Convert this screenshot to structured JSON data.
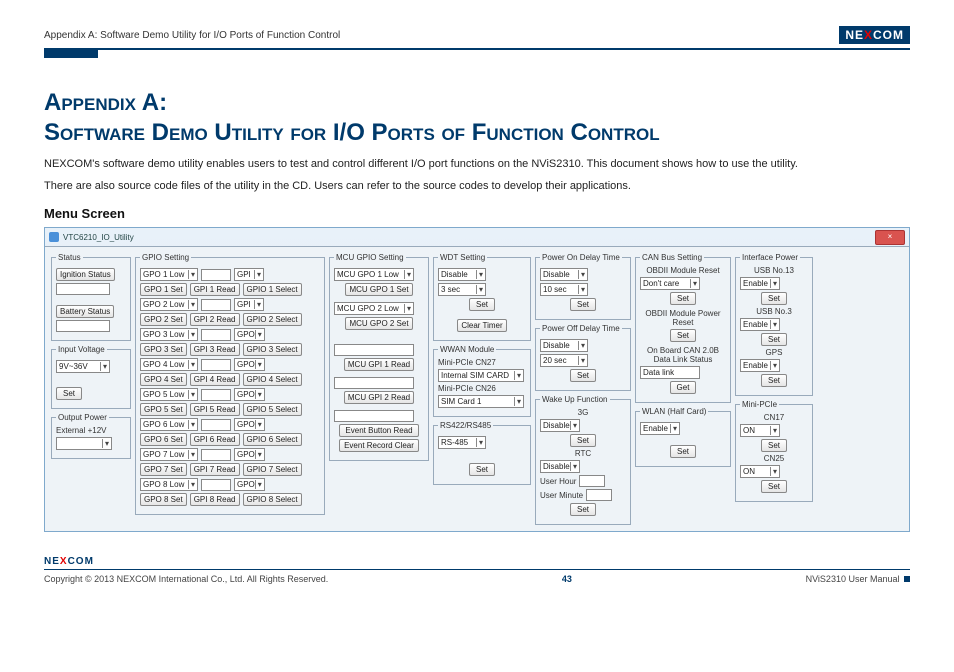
{
  "header": {
    "crumb": "Appendix A: Software Demo Utility for I/O Ports of Function Control",
    "brand_pre": "NE",
    "brand_x": "X",
    "brand_post": "COM"
  },
  "title_line1": "Appendix A:",
  "title_line2": "Software Demo Utility for I/O Ports of Function Control",
  "para1": "NEXCOM's software demo utility enables users to test and control different I/O port functions on the NViS2310. This document shows how to use the utility.",
  "para2": "There are also source code files of the utility in the CD. Users can refer to the source codes to develop their applications.",
  "menu_heading": "Menu Screen",
  "win": {
    "title": "VTC6210_IO_Utility",
    "close": "×",
    "status": {
      "legend": "Status",
      "btn1": "Ignition Status",
      "btn2": "Battery Status"
    },
    "inputv": {
      "legend": "Input Voltage",
      "sel": "9V~36V",
      "btn": "Set"
    },
    "outp": {
      "legend": "Output Power",
      "lbl": "External +12V"
    },
    "gpio": {
      "legend": "GPIO Setting",
      "rows": [
        {
          "sel": "GPO 1 Low",
          "set": "GPO 1 Set",
          "read": "GPI 1 Read",
          "sbtn": "GPIO 1 Select",
          "sel2": "GPI"
        },
        {
          "sel": "GPO 2 Low",
          "set": "GPO 2 Set",
          "read": "GPI 2 Read",
          "sbtn": "GPIO 2 Select",
          "sel2": "GPI"
        },
        {
          "sel": "GPO 3 Low",
          "set": "GPO 3 Set",
          "read": "GPI 3 Read",
          "sbtn": "GPIO 3 Select",
          "sel2": "GPO"
        },
        {
          "sel": "GPO 4 Low",
          "set": "GPO 4 Set",
          "read": "GPI 4 Read",
          "sbtn": "GPIO 4 Select",
          "sel2": "GPO"
        },
        {
          "sel": "GPO 5 Low",
          "set": "GPO 5 Set",
          "read": "GPI 5 Read",
          "sbtn": "GPIO 5 Select",
          "sel2": "GPO"
        },
        {
          "sel": "GPO 6 Low",
          "set": "GPO 6 Set",
          "read": "GPI 6 Read",
          "sbtn": "GPIO 6 Select",
          "sel2": "GPO"
        },
        {
          "sel": "GPO 7 Low",
          "set": "GPO 7 Set",
          "read": "GPI 7 Read",
          "sbtn": "GPIO 7 Select",
          "sel2": "GPO"
        },
        {
          "sel": "GPO 8 Low",
          "set": "GPO 8 Set",
          "read": "GPI 8 Read",
          "sbtn": "GPIO 8 Select",
          "sel2": "GPO"
        }
      ]
    },
    "mcugpio": {
      "legend": "MCU GPIO Setting",
      "sel1": "MCU GPO 1 Low",
      "btn1": "MCU GPO 1 Set",
      "sel2": "MCU GPO 2 Low",
      "btn2": "MCU GPO 2 Set",
      "btn3": "MCU GPI 1 Read",
      "btn4": "MCU GPI 2 Read",
      "btn5": "Event Button Read",
      "btn6": "Event Record Clear"
    },
    "wdt": {
      "legend": "WDT Setting",
      "sel1": "Disable",
      "sel2": "3 sec",
      "btn1": "Set",
      "btn2": "Clear Timer"
    },
    "wwan": {
      "legend": "WWAN Module",
      "l1": "Mini-PCIe CN27",
      "sel1": "Internal SIM CARD",
      "l2": "Mini-PCIe CN26",
      "sel2": "SIM Card 1"
    },
    "rs": {
      "legend": "RS422/RS485",
      "sel": "RS-485",
      "btn": "Set"
    },
    "pon": {
      "legend": "Power On Delay Time",
      "sel1": "Disable",
      "sel2": "10 sec",
      "btn": "Set"
    },
    "poff": {
      "legend": "Power Off Delay Time",
      "sel1": "Disable",
      "sel2": "20 sec",
      "btn": "Set"
    },
    "wake": {
      "legend": "Wake Up Function",
      "l1": "3G",
      "sel1": "Disable",
      "btn1": "Set",
      "l2": "RTC",
      "sel2": "Disable",
      "l3": "User Hour",
      "l4": "User Minute",
      "btn2": "Set"
    },
    "can": {
      "legend": "CAN Bus Setting",
      "l1": "OBDII Module Reset",
      "sel1": "Don't care",
      "btn1": "Set",
      "l2": "OBDII Module Power Reset",
      "btn2": "Set",
      "l3": "On Board CAN 2.0B Data Link Status",
      "sel3": "Data link",
      "btn3": "Get"
    },
    "wlan": {
      "legend": "WLAN (Half Card)",
      "sel": "Enable",
      "btn": "Set"
    },
    "ifp": {
      "legend": "Interface Power",
      "l1": "USB No.13",
      "sel1": "Enable",
      "btn1": "Set",
      "l2": "USB No.3",
      "sel2": "Enable",
      "btn2": "Set",
      "l3": "GPS",
      "sel3": "Enable",
      "btn3": "Set"
    },
    "mpcie": {
      "legend": "Mini-PCIe",
      "l1": "CN17",
      "sel1": "ON",
      "btn1": "Set",
      "l2": "CN25",
      "sel2": "ON",
      "btn2": "Set"
    }
  },
  "footer": {
    "copy": "Copyright © 2013 NEXCOM International Co., Ltd. All Rights Reserved.",
    "page": "43",
    "doc": "NViS2310 User Manual"
  }
}
